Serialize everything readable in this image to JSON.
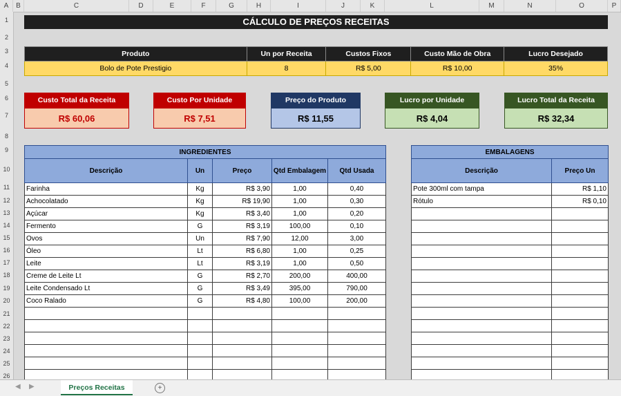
{
  "columns": [
    "A",
    "B",
    "C",
    "D",
    "E",
    "F",
    "G",
    "H",
    "I",
    "J",
    "K",
    "L",
    "M",
    "N",
    "O",
    "P"
  ],
  "rows": [
    "1",
    "2",
    "3",
    "4",
    "5",
    "6",
    "7",
    "8",
    "9",
    "10",
    "11",
    "12",
    "13",
    "14",
    "15",
    "16",
    "17",
    "18",
    "19",
    "20",
    "21",
    "22",
    "23",
    "24",
    "25",
    "26"
  ],
  "title": "CÁLCULO DE PREÇOS RECEITAS",
  "info": {
    "headers": [
      "Produto",
      "Un por Receita",
      "Custos Fixos",
      "Custo Mão de Obra",
      "Lucro Desejado"
    ],
    "values": [
      "Bolo de Pote Prestigio",
      "8",
      "R$ 5,00",
      "R$ 10,00",
      "35%"
    ]
  },
  "cards": [
    {
      "label": "Custo Total da Receita",
      "value": "R$ 60,06",
      "header_color": "#c00000",
      "value_bg": "#f8cbad"
    },
    {
      "label": "Custo Por Unidade",
      "value": "R$ 7,51",
      "header_color": "#c00000",
      "value_bg": "#f8cbad"
    },
    {
      "label": "Preço do Produto",
      "value": "R$ 11,55",
      "header_color": "#203864",
      "value_bg": "#b4c6e7"
    },
    {
      "label": "Lucro por Unidade",
      "value": "R$ 4,04",
      "header_color": "#375623",
      "value_bg": "#c6e0b4"
    },
    {
      "label": "Lucro Total da Receita",
      "value": "R$ 32,34",
      "header_color": "#375623",
      "value_bg": "#c6e0b4"
    }
  ],
  "ingredients": {
    "title": "INGREDIENTES",
    "headers": [
      "Descrição",
      "Un",
      "Preço",
      "Qtd Embalagem",
      "Qtd Usada"
    ],
    "rows": [
      [
        "Farinha",
        "Kg",
        "R$ 3,90",
        "1,00",
        "0,40"
      ],
      [
        "Achocolatado",
        "Kg",
        "R$ 19,90",
        "1,00",
        "0,30"
      ],
      [
        "Açúcar",
        "Kg",
        "R$ 3,40",
        "1,00",
        "0,20"
      ],
      [
        "Fermento",
        "G",
        "R$ 3,19",
        "100,00",
        "0,10"
      ],
      [
        "Ovos",
        "Un",
        "R$ 7,90",
        "12,00",
        "3,00"
      ],
      [
        "Óleo",
        "Lt",
        "R$ 6,80",
        "1,00",
        "0,25"
      ],
      [
        "Leite",
        "Lt",
        "R$ 3,19",
        "1,00",
        "0,50"
      ],
      [
        "Creme de Leite Lt",
        "G",
        "R$ 2,70",
        "200,00",
        "400,00"
      ],
      [
        "Leite Condensado Lt",
        "G",
        "R$ 3,49",
        "395,00",
        "790,00"
      ],
      [
        "Coco Ralado",
        "G",
        "R$ 4,80",
        "100,00",
        "200,00"
      ]
    ],
    "empty_rows": 6
  },
  "packaging": {
    "title": "EMBALAGENS",
    "headers": [
      "Descrição",
      "Preço Un"
    ],
    "rows": [
      [
        "Pote 300ml com tampa",
        "R$ 1,10"
      ],
      [
        "Rótulo",
        "R$ 0,10"
      ]
    ],
    "empty_rows": 14
  },
  "sheet_tab": "Preços Receitas",
  "accent": "#217346"
}
